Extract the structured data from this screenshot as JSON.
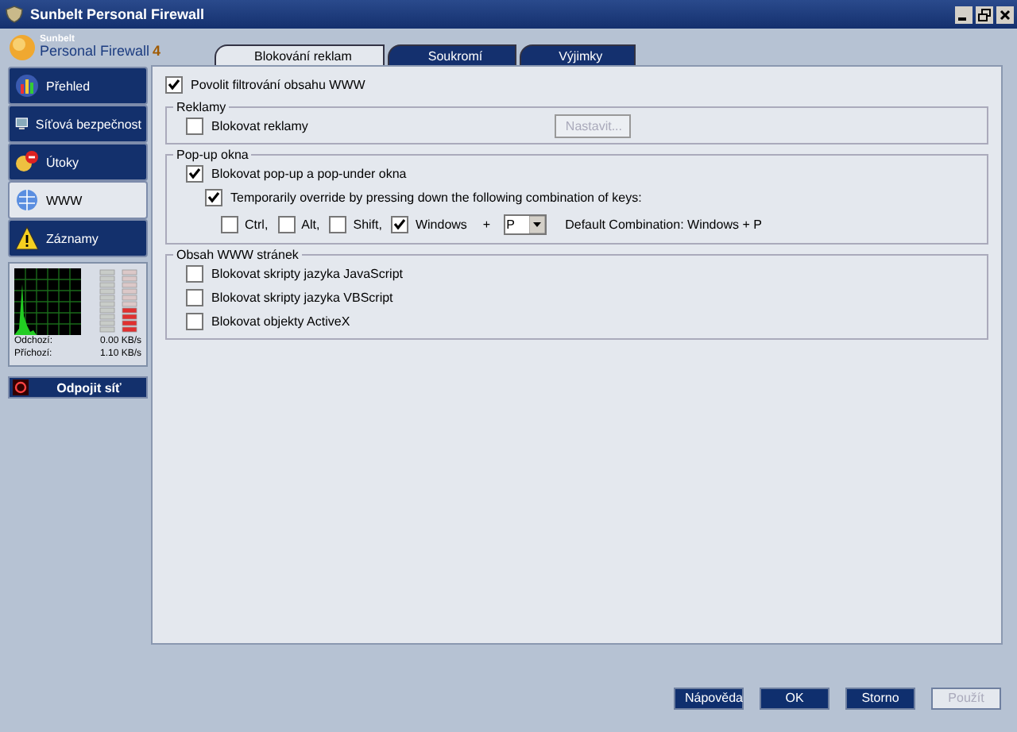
{
  "window": {
    "title": "Sunbelt Personal Firewall"
  },
  "logo": {
    "brand": "Sunbelt",
    "product": "Personal Firewall",
    "version": "4"
  },
  "sidebar": {
    "items": [
      {
        "label": "Přehled",
        "kind": "chart",
        "selected": false
      },
      {
        "label": "Síťová bezpečnost",
        "kind": "network",
        "selected": false
      },
      {
        "label": "Útoky",
        "kind": "attack",
        "selected": false
      },
      {
        "label": "WWW",
        "kind": "globe",
        "selected": true
      },
      {
        "label": "Záznamy",
        "kind": "warning",
        "selected": false
      }
    ]
  },
  "monitor": {
    "rows": [
      {
        "label": "Odchozí:",
        "value": "0.00 KB/s"
      },
      {
        "label": "Příchozí:",
        "value": "1.10 KB/s"
      }
    ]
  },
  "disconnect_button": {
    "label": "Odpojit síť"
  },
  "tabs": [
    {
      "label": "Blokování reklam",
      "selected": true
    },
    {
      "label": "Soukromí",
      "selected": false
    },
    {
      "label": "Výjimky",
      "selected": false
    }
  ],
  "enable": {
    "label": "Povolit filtrování obsahu WWW",
    "checked": true
  },
  "groups": [
    {
      "title": "Reklamy",
      "rows": [
        {
          "kind": "checkbox-button",
          "label": "Blokovat reklamy",
          "checked": false,
          "button": {
            "label": "Nastavit...",
            "disabled": true
          }
        }
      ]
    },
    {
      "title": "Pop-up okna",
      "rows": [
        {
          "kind": "checkbox",
          "label": "Blokovat pop-up a pop-under okna",
          "checked": true
        },
        {
          "kind": "sub-checkbox",
          "label": "Temporarily override by pressing down the following combination of keys:",
          "checked": true
        },
        {
          "kind": "keys",
          "keys": [
            {
              "label": "Ctrl,",
              "checked": false
            },
            {
              "label": "Alt,",
              "checked": false
            },
            {
              "label": "Shift,",
              "checked": false
            },
            {
              "label": "Windows",
              "checked": true
            }
          ],
          "plus": "+",
          "key": "P",
          "default": "Default Combination: Windows + P"
        }
      ]
    },
    {
      "title": "Obsah WWW stránek",
      "rows": [
        {
          "kind": "checkbox",
          "label": "Blokovat skripty jazyka JavaScript",
          "checked": false
        },
        {
          "kind": "checkbox",
          "label": "Blokovat skripty jazyka VBScript",
          "checked": false
        },
        {
          "kind": "checkbox",
          "label": "Blokovat objekty ActiveX",
          "checked": false
        }
      ]
    }
  ],
  "buttons": [
    {
      "label": "Nápověda",
      "disabled": false
    },
    {
      "label": "OK",
      "disabled": false
    },
    {
      "label": "Storno",
      "disabled": false
    },
    {
      "label": "Použít",
      "disabled": true
    }
  ]
}
